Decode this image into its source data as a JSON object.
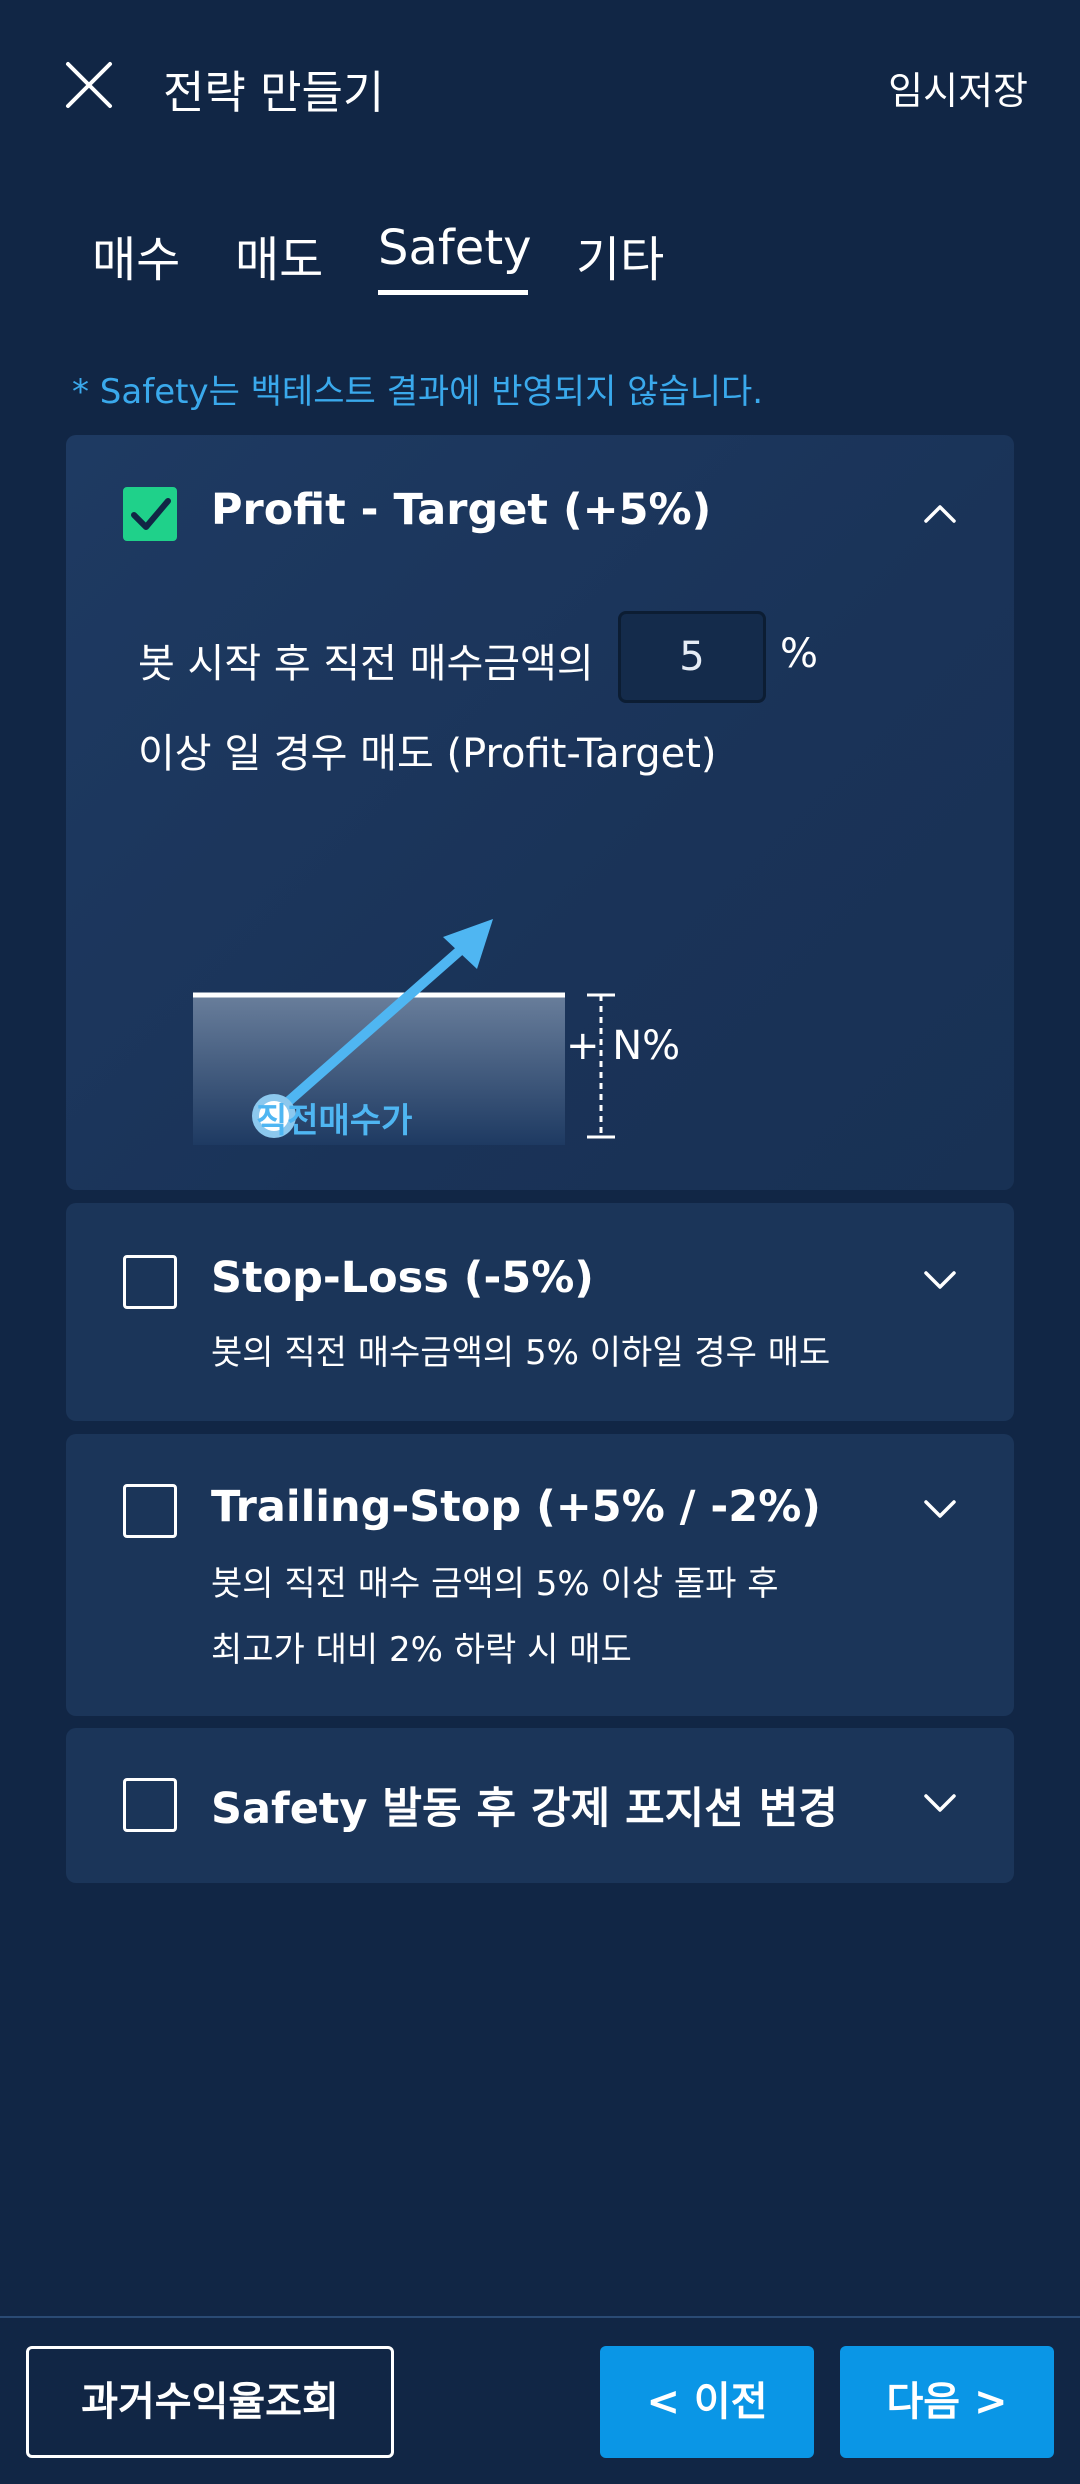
{
  "header": {
    "title": "전략 만들기",
    "save_draft": "임시저장"
  },
  "tabs": [
    {
      "label": "매수"
    },
    {
      "label": "매도"
    },
    {
      "label": "Safety",
      "active": true
    },
    {
      "label": "기타"
    }
  ],
  "notice": "* Safety는 백테스트 결과에 반영되지 않습니다.",
  "cards": {
    "profit_target": {
      "title": "Profit - Target (+5%)",
      "checked": true,
      "expanded": true,
      "line1_prefix": "봇 시작 후 직전 매수금액의",
      "input_value": "5",
      "unit": "%",
      "line2": "이상 일 경우 매도 (Profit-Target)",
      "diagram_point_label": "직전매수가",
      "diagram_range_label": "+ N%"
    },
    "stop_loss": {
      "title": "Stop-Loss (-5%)",
      "checked": false,
      "desc": "봇의 직전 매수금액의 5% 이하일 경우 매도"
    },
    "trailing_stop": {
      "title": "Trailing-Stop (+5% / -2%)",
      "checked": false,
      "desc_line1": "봇의 직전 매수 금액의 5% 이상 돌파 후",
      "desc_line2": "최고가 대비 2% 하락 시 매도"
    },
    "forced_position": {
      "title": "Safety 발동 후 강제 포지션 변경",
      "checked": false
    }
  },
  "footer": {
    "history_button": "과거수익율조회",
    "prev_button": "< 이전",
    "next_button": "다음 >"
  },
  "colors": {
    "background": "#112645",
    "card": "#1b3559",
    "accent_blue": "#0a96e6",
    "notice_blue": "#3aa9ec",
    "checkbox_green": "#1fd18a"
  }
}
